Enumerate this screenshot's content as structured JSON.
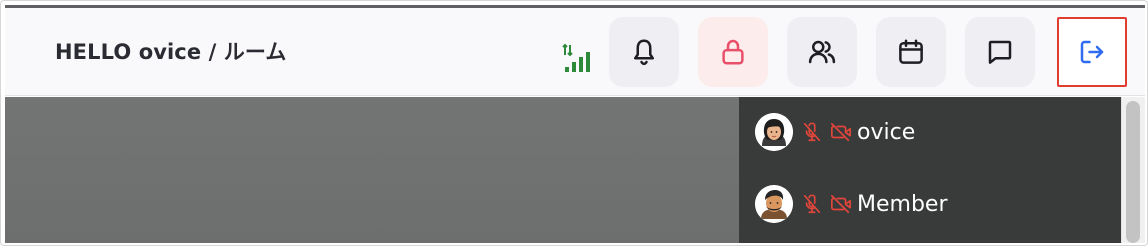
{
  "header": {
    "room_title": "HELLO ovice / ルーム",
    "buttons": [
      {
        "name": "notifications",
        "icon": "bell-icon"
      },
      {
        "name": "lock",
        "icon": "lock-icon"
      },
      {
        "name": "members",
        "icon": "users-icon"
      },
      {
        "name": "calendar",
        "icon": "calendar-icon"
      },
      {
        "name": "chat",
        "icon": "chat-icon"
      },
      {
        "name": "exit",
        "icon": "exit-icon"
      }
    ],
    "signal_icon": "signal-strength-icon"
  },
  "members": [
    {
      "name": "ovice",
      "mic": "muted",
      "camera": "off"
    },
    {
      "name": "Member",
      "mic": "muted",
      "camera": "off"
    }
  ],
  "colors": {
    "header_bg": "#f9f9fb",
    "button_bg": "#efeff3",
    "lock_button_bg": "#fdecec",
    "lock_icon": "#e8506a",
    "exit_icon": "#2f6cf0",
    "exit_highlight": "#e03d2f",
    "signal": "#2e8a3b",
    "muted_icon": "#e2463a",
    "member_panel_bg": "#393b3b"
  }
}
